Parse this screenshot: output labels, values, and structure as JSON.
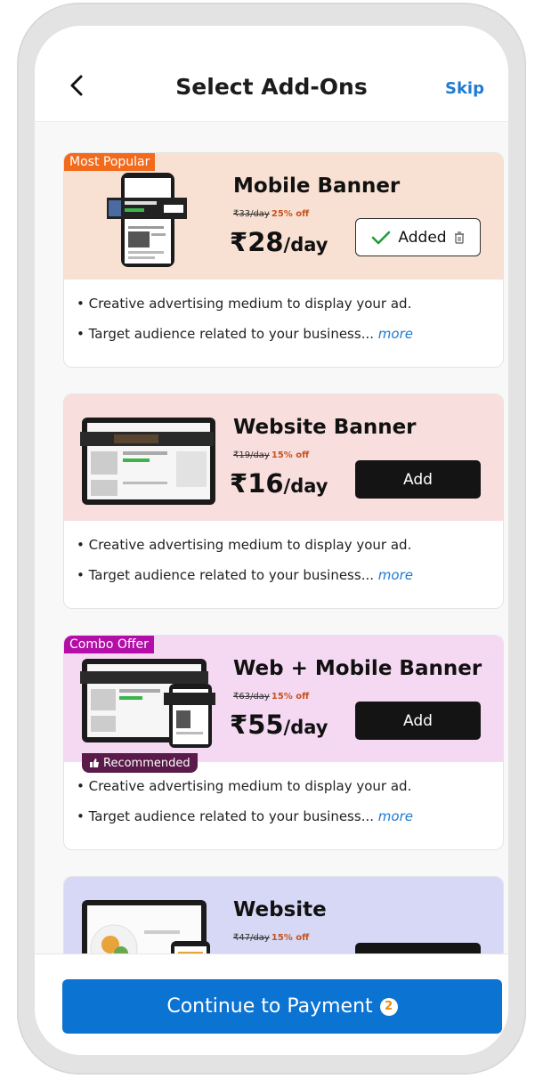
{
  "header": {
    "title": "Select Add-Ons",
    "skip_label": "Skip"
  },
  "cards": [
    {
      "badge": "Most Popular",
      "badge_color": "#f26b1d",
      "bg": "#f8e1d2",
      "name": "Mobile Banner",
      "old_price": "₹33/day",
      "discount": "25% off",
      "price_currency": "₹",
      "price_amount": "28",
      "price_unit": "/day",
      "button_label": "Added",
      "state": "added",
      "bullets": [
        "Creative advertising medium to display your ad.",
        "Target audience related to your business..."
      ],
      "more": "more"
    },
    {
      "bg": "#f9dede",
      "name": "Website Banner",
      "old_price": "₹19/day",
      "discount": "15% off",
      "price_currency": "₹",
      "price_amount": "16",
      "price_unit": "/day",
      "button_label": "Add",
      "state": "add",
      "bullets": [
        "Creative advertising medium to display your ad.",
        "Target audience related to your business..."
      ],
      "more": "more"
    },
    {
      "badge": "Combo Offer",
      "badge_color": "#b40ea8",
      "bg": "#f5d9f3",
      "name": "Web + Mobile Banner",
      "old_price": "₹63/day",
      "discount": "15% off",
      "price_currency": "₹",
      "price_amount": "55",
      "price_unit": "/day",
      "button_label": "Add",
      "state": "add",
      "recommended": "Recommended",
      "bullets": [
        "Creative advertising medium to display your ad.",
        "Target audience related to your business..."
      ],
      "more": "more"
    },
    {
      "bg": "#d6d8f5",
      "name": "Website",
      "old_price": "₹47/day",
      "discount": "15% off"
    }
  ],
  "footer": {
    "cta_label": "Continue to Payment",
    "count": "2",
    "cta_color": "#0b73d2"
  }
}
